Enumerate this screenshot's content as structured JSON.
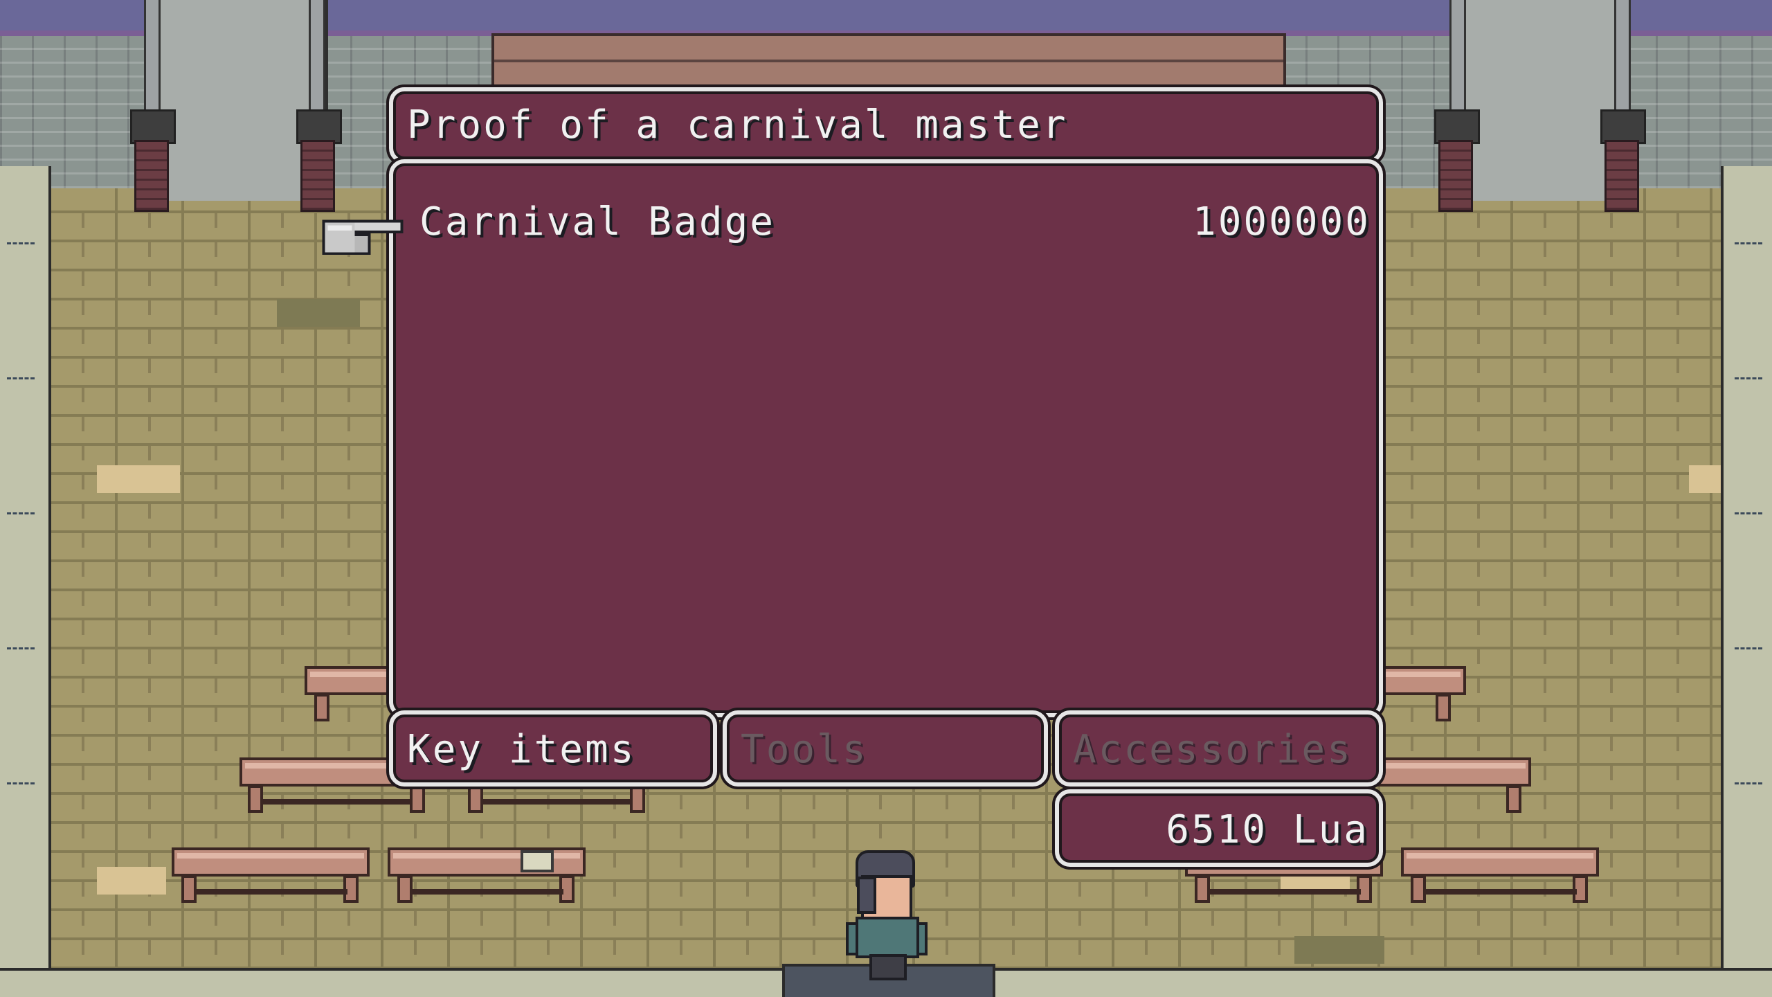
{
  "shop": {
    "description": "Proof of a carnival master",
    "items": [
      {
        "name": "Carnival Badge",
        "price": "1000000"
      }
    ],
    "categories": [
      {
        "label": "Key items",
        "active": true
      },
      {
        "label": "Tools",
        "active": false
      },
      {
        "label": "Accessories",
        "active": false
      }
    ],
    "money": "6510 Lua"
  },
  "colors": {
    "window_bg": "#6c3148",
    "window_border": "#e6e6e6",
    "text": "#f1f1f1",
    "text_disabled": "#6a5a60"
  },
  "icons": {
    "cursor": "pointing-hand-icon"
  }
}
